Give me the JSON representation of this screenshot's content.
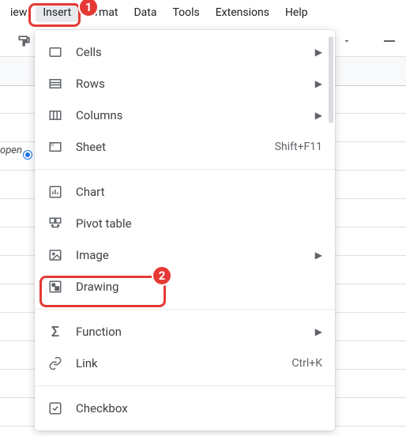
{
  "menubar": {
    "view": "iew",
    "insert": "Insert",
    "format": "rmat",
    "data": "Data",
    "tools": "Tools",
    "extensions": "Extensions",
    "help": "Help"
  },
  "sheet_chip": "open",
  "menu": {
    "cells": "Cells",
    "rows": "Rows",
    "columns": "Columns",
    "sheet": "Sheet",
    "sheet_shortcut": "Shift+F11",
    "chart": "Chart",
    "pivot": "Pivot table",
    "image": "Image",
    "drawing": "Drawing",
    "function": "Function",
    "link": "Link",
    "link_shortcut": "Ctrl+K",
    "checkbox": "Checkbox"
  },
  "annotations": {
    "badge1": "1",
    "badge2": "2"
  }
}
